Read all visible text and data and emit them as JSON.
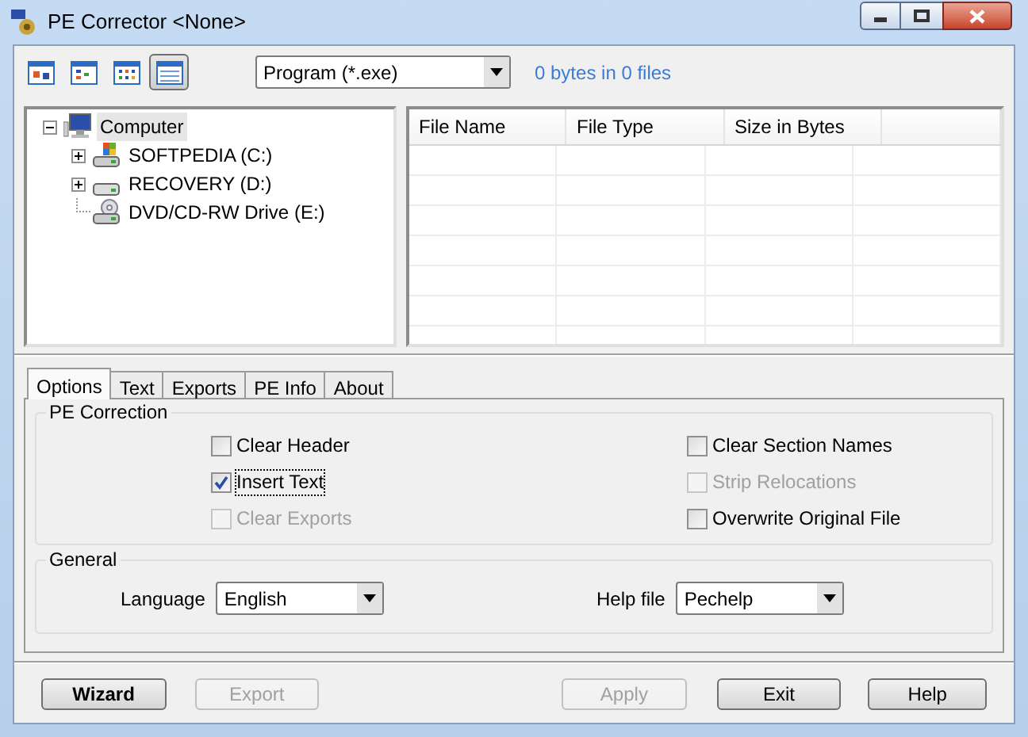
{
  "window": {
    "title": "PE Corrector <None>"
  },
  "toolbar": {
    "views": [
      {
        "kind": "large",
        "selected": false
      },
      {
        "kind": "small",
        "selected": false
      },
      {
        "kind": "list",
        "selected": false
      },
      {
        "kind": "details",
        "selected": true
      }
    ],
    "filter": {
      "value": "Program (*.exe)"
    },
    "summary": "0 bytes in 0 files"
  },
  "tree": [
    {
      "label": "Computer",
      "kind": "computer",
      "has_children": true,
      "expanded": true,
      "selected": true,
      "children": [
        {
          "label": "SOFTPEDIA (C:)",
          "kind": "system-drive",
          "has_children": true,
          "expanded": false,
          "selected": false
        },
        {
          "label": "RECOVERY (D:)",
          "kind": "drive",
          "has_children": true,
          "expanded": false,
          "selected": false
        },
        {
          "label": "DVD/CD-RW Drive (E:)",
          "kind": "optical-drive",
          "has_children": false,
          "selected": false
        }
      ]
    }
  ],
  "file_table": {
    "columns": [
      "File Name",
      "File Type",
      "Size in Bytes"
    ]
  },
  "tabs": [
    {
      "label": "Options",
      "selected": true
    },
    {
      "label": "Text",
      "selected": false
    },
    {
      "label": "Exports",
      "selected": false
    },
    {
      "label": "PE Info",
      "selected": false
    },
    {
      "label": "About",
      "selected": false
    }
  ],
  "pe_correction": {
    "title": "PE Correction",
    "columns": [
      [
        {
          "label": "Clear Header",
          "checked": false,
          "disabled": false,
          "focused": false
        },
        {
          "label": "Insert Text",
          "checked": true,
          "disabled": false,
          "focused": true
        },
        {
          "label": "Clear Exports",
          "checked": false,
          "disabled": true,
          "focused": false
        }
      ],
      [
        {
          "label": "Clear Section Names",
          "checked": false,
          "disabled": false,
          "focused": false
        },
        {
          "label": "Strip Relocations",
          "checked": false,
          "disabled": true,
          "focused": false
        },
        {
          "label": "Overwrite Original File",
          "checked": false,
          "disabled": false,
          "focused": false
        }
      ]
    ]
  },
  "general": {
    "title": "General",
    "fields": [
      {
        "label": "Language",
        "value": "English"
      },
      {
        "label": "Help file",
        "value": "Pechelp"
      }
    ]
  },
  "buttons": [
    {
      "label": "Wizard",
      "default": true,
      "disabled": false
    },
    {
      "label": "Export",
      "default": false,
      "disabled": true
    },
    {
      "label": "Apply",
      "default": false,
      "disabled": true
    },
    {
      "label": "Exit",
      "default": false,
      "disabled": false
    },
    {
      "label": "Help",
      "default": false,
      "disabled": false
    }
  ]
}
